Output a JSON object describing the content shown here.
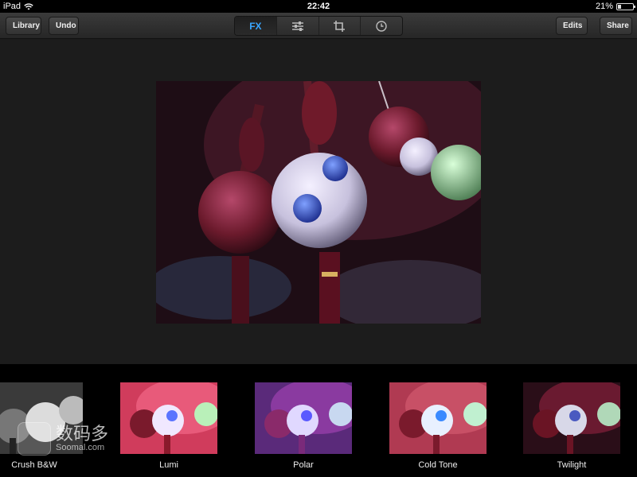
{
  "status_bar": {
    "device": "iPad",
    "time": "22:42",
    "battery": "21%",
    "battery_level": 0.21
  },
  "toolbar": {
    "library_label": "Library",
    "undo_label": "Undo",
    "edits_label": "Edits",
    "share_label": "Share",
    "tabs": [
      {
        "label": "FX",
        "icon": "fx",
        "active": true
      },
      {
        "label": "",
        "icon": "sliders-icon",
        "active": false
      },
      {
        "label": "",
        "icon": "crop-icon",
        "active": false
      },
      {
        "label": "",
        "icon": "clock-icon",
        "active": false
      }
    ]
  },
  "filters": [
    {
      "label": "Crush B&W"
    },
    {
      "label": "Lumi"
    },
    {
      "label": "Polar"
    },
    {
      "label": "Cold Tone"
    },
    {
      "label": "Twilight"
    }
  ],
  "watermark": {
    "title": "数码多",
    "subtitle": "Soomal.com"
  },
  "colors": {
    "accent": "#3aa7ff",
    "toolbar": "#2e2e2e",
    "background": "#1c1c1c"
  }
}
